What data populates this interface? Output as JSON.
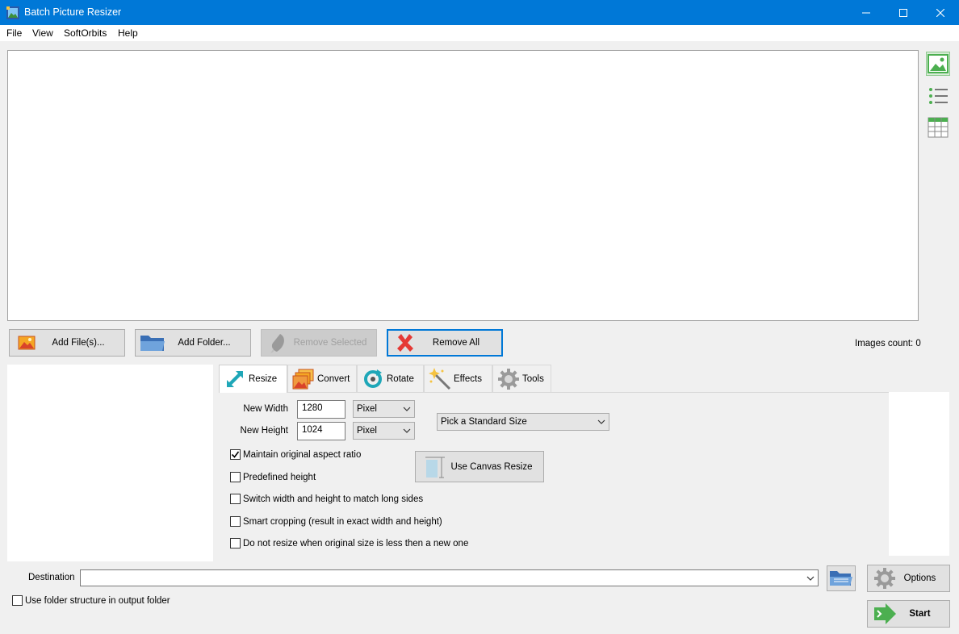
{
  "window": {
    "title": "Batch Picture Resizer"
  },
  "menu": [
    {
      "label": "File"
    },
    {
      "label": "View"
    },
    {
      "label": "SoftOrbits"
    },
    {
      "label": "Help"
    }
  ],
  "view_icons": [
    "image-view-icon",
    "list-view-icon",
    "table-view-icon"
  ],
  "buttons": {
    "add_files": "Add File(s)...",
    "add_folder": "Add Folder...",
    "remove_selected": "Remove Selected",
    "remove_all": "Remove All"
  },
  "images_count": "Images count: 0",
  "tabs": [
    {
      "label": "Resize",
      "active": true
    },
    {
      "label": "Convert"
    },
    {
      "label": "Rotate"
    },
    {
      "label": "Effects"
    },
    {
      "label": "Tools"
    }
  ],
  "resize": {
    "width_label": "New Width",
    "width_value": "1280",
    "width_unit": "Pixel",
    "height_label": "New Height",
    "height_value": "1024",
    "height_unit": "Pixel",
    "standard_size": "Pick a Standard Size",
    "canvas_button": "Use Canvas Resize",
    "options": [
      {
        "label": "Maintain original aspect ratio",
        "checked": true
      },
      {
        "label": "Predefined height",
        "checked": false
      },
      {
        "label": "Switch width and height to match long sides",
        "checked": false
      },
      {
        "label": "Smart cropping (result in exact width and height)",
        "checked": false
      },
      {
        "label": "Do not resize when original size is less then a new one",
        "checked": false
      }
    ]
  },
  "destination": {
    "label": "Destination",
    "value": "",
    "folder_structure_label": "Use folder structure in output folder",
    "folder_structure_checked": false
  },
  "actions": {
    "options": "Options",
    "start": "Start"
  },
  "colors": {
    "titlebar": "#0078d7",
    "accent_green": "#4caf50",
    "remove_red": "#e53935"
  }
}
